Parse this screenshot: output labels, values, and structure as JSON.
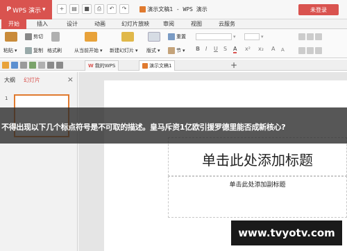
{
  "titlebar": {
    "app_menu_label": "WPS 演示",
    "app_logo": "P",
    "title": "演示文稿1 - WPS 演示",
    "login_label": "未登录"
  },
  "menu_tabs": [
    "开始",
    "插入",
    "设计",
    "动画",
    "幻灯片放映",
    "审阅",
    "视图",
    "云服务"
  ],
  "ribbon": {
    "paste": "粘贴",
    "cut": "剪切",
    "copy": "复制",
    "format_painter": "格式刷",
    "from_current": "从当前开始",
    "new_slide": "新建幻灯片",
    "layout": "版式",
    "reset": "重置",
    "section": "节",
    "font_formats": [
      "B",
      "I",
      "U",
      "S",
      "A",
      "x²",
      "x₂",
      "A",
      "A"
    ]
  },
  "doc_tabs": [
    {
      "label": "我的WPS"
    },
    {
      "label": "演示文稿1"
    }
  ],
  "left_panel": {
    "outline_tab": "大纲",
    "slides_tab": "幻灯片",
    "thumb_number": "1"
  },
  "slide": {
    "title_placeholder": "单击此处添加标题",
    "subtitle_placeholder": "单击此处添加副标题"
  },
  "banner": {
    "text": "不得出现以下几个标点符号是不可取的描述。皇马斥资1亿欧引援罗德里能否成新核心?"
  },
  "watermark": {
    "text": "www.tvyotv.com"
  },
  "colors": {
    "accent": "#d9534f",
    "thumb_border": "#e07a2f"
  }
}
